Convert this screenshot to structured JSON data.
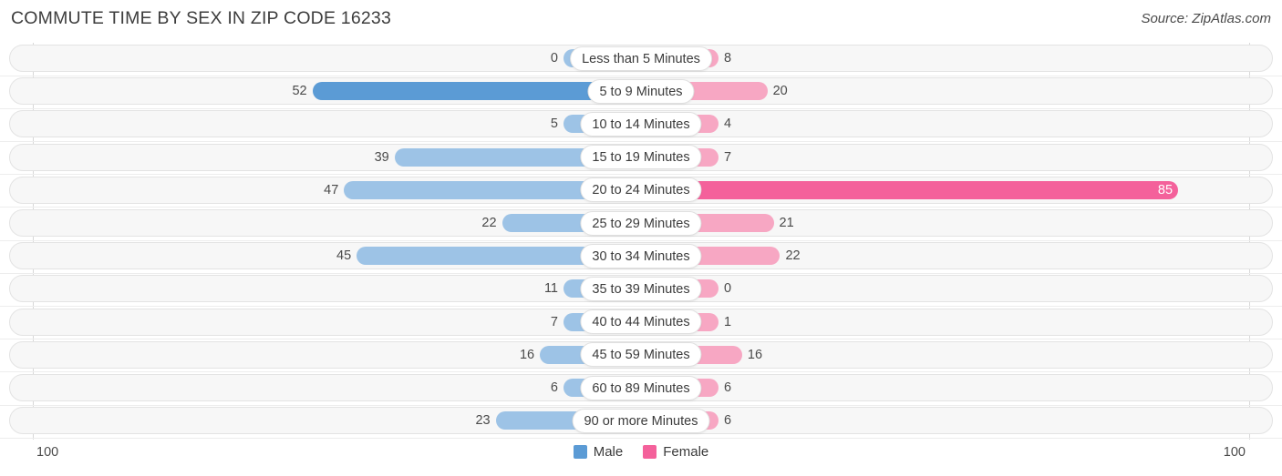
{
  "header": {
    "title": "COMMUTE TIME BY SEX IN ZIP CODE 16233",
    "source": "Source: ZipAtlas.com"
  },
  "legend": {
    "male": {
      "label": "Male",
      "color": "#5B9BD5"
    },
    "female": {
      "label": "Female",
      "color": "#F4619B"
    }
  },
  "axis": {
    "left_max": "100",
    "right_max": "100"
  },
  "colors": {
    "male_light": "#9DC3E6",
    "male_dark": "#5B9BD5",
    "female_light": "#F7A7C3",
    "female_dark": "#F4619B",
    "track": "#F7F7F7",
    "track_border": "#E3E3E3"
  },
  "chart_data": {
    "type": "bar",
    "orientation": "horizontal",
    "layout": "diverging-bidirectional",
    "title": "COMMUTE TIME BY SEX IN ZIP CODE 16233",
    "xlabel": "",
    "ylabel": "",
    "xlim": [
      100,
      100
    ],
    "grid": false,
    "legend_position": "bottom-center",
    "categories": [
      "Less than 5 Minutes",
      "5 to 9 Minutes",
      "10 to 14 Minutes",
      "15 to 19 Minutes",
      "20 to 24 Minutes",
      "25 to 29 Minutes",
      "30 to 34 Minutes",
      "35 to 39 Minutes",
      "40 to 44 Minutes",
      "45 to 59 Minutes",
      "60 to 89 Minutes",
      "90 or more Minutes"
    ],
    "series": [
      {
        "name": "Male",
        "side": "left",
        "values": [
          0,
          52,
          5,
          39,
          47,
          22,
          45,
          11,
          7,
          16,
          6,
          23
        ]
      },
      {
        "name": "Female",
        "side": "right",
        "values": [
          8,
          20,
          4,
          7,
          85,
          21,
          22,
          0,
          1,
          16,
          6,
          6
        ]
      }
    ]
  },
  "rows": [
    {
      "label": "Less than 5 Minutes",
      "male": "0",
      "female": "8"
    },
    {
      "label": "5 to 9 Minutes",
      "male": "52",
      "female": "20"
    },
    {
      "label": "10 to 14 Minutes",
      "male": "5",
      "female": "4"
    },
    {
      "label": "15 to 19 Minutes",
      "male": "39",
      "female": "7"
    },
    {
      "label": "20 to 24 Minutes",
      "male": "47",
      "female": "85"
    },
    {
      "label": "25 to 29 Minutes",
      "male": "22",
      "female": "21"
    },
    {
      "label": "30 to 34 Minutes",
      "male": "45",
      "female": "22"
    },
    {
      "label": "35 to 39 Minutes",
      "male": "11",
      "female": "0"
    },
    {
      "label": "40 to 44 Minutes",
      "male": "7",
      "female": "1"
    },
    {
      "label": "45 to 59 Minutes",
      "male": "16",
      "female": "16"
    },
    {
      "label": "60 to 89 Minutes",
      "male": "6",
      "female": "6"
    },
    {
      "label": "90 or more Minutes",
      "male": "23",
      "female": "6"
    }
  ]
}
